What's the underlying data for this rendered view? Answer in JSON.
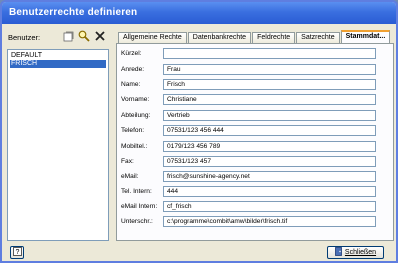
{
  "window": {
    "title": "Benutzerrechte definieren"
  },
  "toolbar": {
    "user_label": "Benutzer:",
    "icons": [
      "new-user-icon",
      "search-user-icon",
      "delete-user-icon"
    ]
  },
  "users": [
    {
      "name": "DEFAULT",
      "selected": false
    },
    {
      "name": "FRISCH",
      "selected": true
    }
  ],
  "tabs": [
    {
      "label": "Allgemeine Rechte",
      "active": false
    },
    {
      "label": "Datenbankrechte",
      "active": false
    },
    {
      "label": "Feldrechte",
      "active": false
    },
    {
      "label": "Satzrechte",
      "active": false
    },
    {
      "label": "Stammdat...",
      "active": true
    }
  ],
  "fields": [
    {
      "label": "Kürzel:",
      "value": ""
    },
    {
      "label": "Anrede:",
      "value": "Frau"
    },
    {
      "label": "Name:",
      "value": "Frisch"
    },
    {
      "label": "Vorname:",
      "value": "Christiane"
    },
    {
      "label": "Abteilung:",
      "value": "Vertrieb"
    },
    {
      "label": "Telefon:",
      "value": "07531/123 456 444"
    },
    {
      "label": "Mobiltel.:",
      "value": "0179/123 456 789"
    },
    {
      "label": "Fax:",
      "value": "07531/123 457"
    },
    {
      "label": "eMail:",
      "value": "frisch@sunshine-agency.net"
    },
    {
      "label": "Tel. Intern:",
      "value": "444"
    },
    {
      "label": "eMail Intern:",
      "value": "cf_frisch"
    },
    {
      "label": "Unterschr.:",
      "value": "c:\\programme\\combit\\amw\\bilder\\frisch.tif"
    }
  ],
  "footer": {
    "close_label": "Schließen",
    "help_icon": "help-icon",
    "close_icon": "door-icon"
  },
  "colors": {
    "titlebar": "#2a5cd3",
    "selection": "#316ac5",
    "active_tab_accent": "#f0a030"
  }
}
